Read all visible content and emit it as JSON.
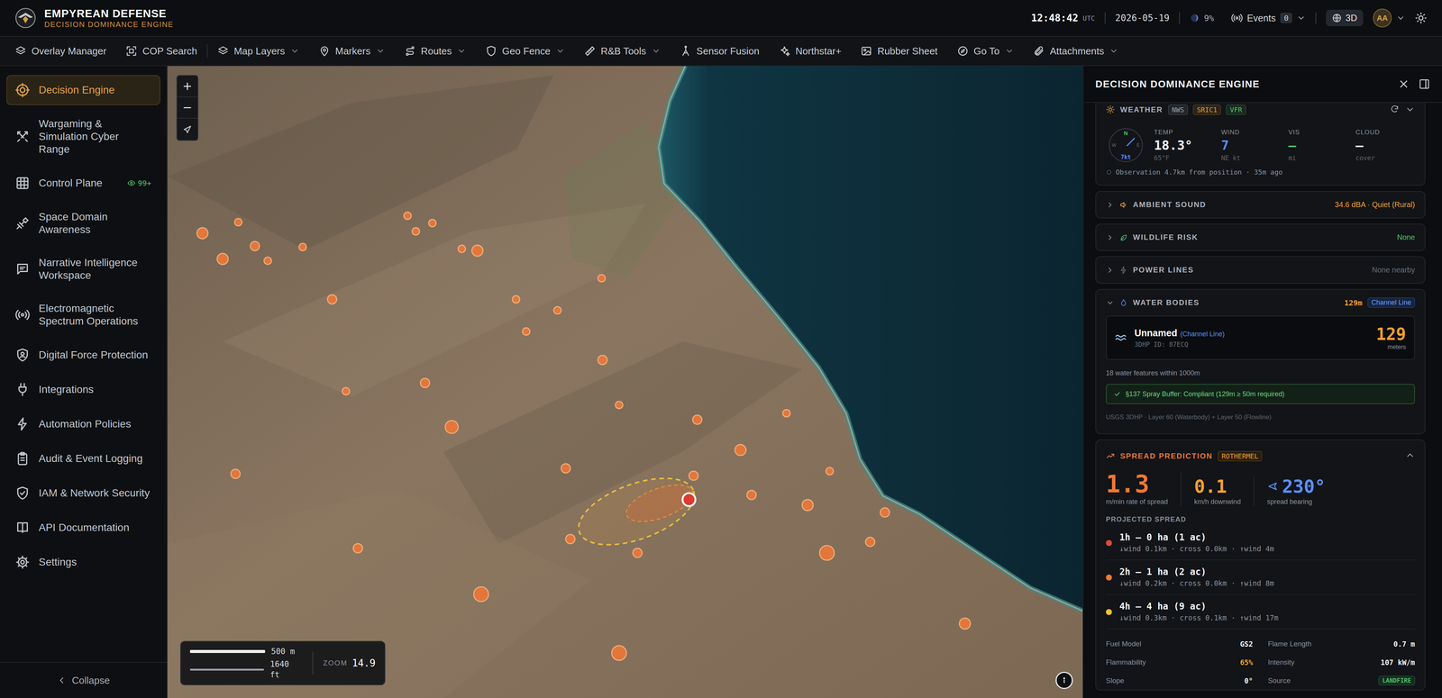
{
  "topbar": {
    "brand": "EMPYREAN DEFENSE",
    "subtitle": "DECISION DOMINANCE ENGINE",
    "time": "12:48:42",
    "timezone": "UTC",
    "date": "2026-05-19",
    "moon_illumination": "9%",
    "events_label": "Events",
    "events_count": "0",
    "view_mode": "3D",
    "avatar": "AA"
  },
  "toolbar": [
    {
      "label": "Overlay Manager",
      "dropdown": false
    },
    {
      "label": "COP Search",
      "dropdown": false
    },
    {
      "label": "Map Layers",
      "dropdown": true
    },
    {
      "label": "Markers",
      "dropdown": true
    },
    {
      "label": "Routes",
      "dropdown": true
    },
    {
      "label": "Geo Fence",
      "dropdown": true
    },
    {
      "label": "R&B Tools",
      "dropdown": true
    },
    {
      "label": "Sensor Fusion",
      "dropdown": false
    },
    {
      "label": "Northstar+",
      "dropdown": false
    },
    {
      "label": "Rubber Sheet",
      "dropdown": false
    },
    {
      "label": "Go To",
      "dropdown": true
    },
    {
      "label": "Attachments",
      "dropdown": true
    }
  ],
  "sidebar": {
    "items": [
      {
        "label": "Decision Engine",
        "selected": true
      },
      {
        "label": "Wargaming & Simulation Cyber Range",
        "selected": false
      },
      {
        "label": "Control Plane",
        "selected": false,
        "badge": "99+"
      },
      {
        "label": "Space Domain Awareness",
        "selected": false
      },
      {
        "label": "Narrative Intelligence Workspace",
        "selected": false
      },
      {
        "label": "Electromagnetic Spectrum Operations",
        "selected": false
      },
      {
        "label": "Digital Force Protection",
        "selected": false
      },
      {
        "label": "Integrations",
        "selected": false
      },
      {
        "label": "Automation Policies",
        "selected": false
      },
      {
        "label": "Audit & Event Logging",
        "selected": false
      },
      {
        "label": "IAM & Network Security",
        "selected": false
      },
      {
        "label": "API Documentation",
        "selected": false
      },
      {
        "label": "Settings",
        "selected": false
      }
    ],
    "collapse": "Collapse"
  },
  "map": {
    "scale_metric": "500 m",
    "scale_imperial": "1640 ft",
    "zoom_label": "ZOOM",
    "zoom": "14.9"
  },
  "panel": {
    "title": "DECISION DOMINANCE ENGINE",
    "weather": {
      "title": "WEATHER",
      "expanded": true,
      "tags": [
        {
          "label": "NWS",
          "color": "#9aa0a6"
        },
        {
          "label": "SRIC1",
          "color": "#e0a030"
        },
        {
          "label": "VFR",
          "color": "#5cc05c"
        }
      ],
      "compass_n": "N",
      "compass_w": "W",
      "compass_e": "E",
      "compass_speed": "7kt",
      "stats": [
        {
          "label": "TEMP",
          "value": "18.3°",
          "unit": "65°F",
          "color": "#f2f3f5"
        },
        {
          "label": "WIND",
          "value": "7",
          "unit": "NE kt",
          "color": "#5b8ff9"
        },
        {
          "label": "VIS",
          "value": "—",
          "unit": "mi",
          "color": "#4cc46a"
        },
        {
          "label": "CLOUD",
          "value": "—",
          "unit": "cover",
          "color": "#f2f3f5"
        }
      ],
      "observation": "Observation 4.7km from position · 35m ago"
    },
    "sections": [
      {
        "title": "AMBIENT SOUND",
        "value": "34.6 dBA · Quiet (Rural)",
        "color": "#f0a030",
        "expanded": false
      },
      {
        "title": "WILDLIFE RISK",
        "value": "None",
        "color": "#4cc46a",
        "expanded": false
      },
      {
        "title": "POWER LINES",
        "value": "None nearby",
        "color": "#6b7078",
        "expanded": false
      }
    ],
    "water": {
      "title": "WATER BODIES",
      "expanded": true,
      "distance": "129m",
      "tag": "Channel Line",
      "name": "Unnamed",
      "type": "(Channel Line)",
      "id": "3DHP ID: 87ECQ",
      "meters": "129",
      "meters_unit": "meters",
      "count": "18 water features within 1000m",
      "compliance": "§137 Spray Buffer: Compliant (129m ≥ 50m required)",
      "source": "USGS 3DHP · Layer 60 (Waterbody) + Layer 50 (Flowline)"
    },
    "spread": {
      "title": "SPREAD PREDICTION",
      "tag": "ROTHERMEL",
      "expanded": true,
      "stats": [
        {
          "value": "1.3",
          "label": "m/min rate of spread",
          "color": "#f07830"
        },
        {
          "value": "0.1",
          "label": "km/h downwind",
          "color": "#f0a030"
        },
        {
          "value": "230°",
          "label": "spread bearing",
          "color": "#5b8ff9"
        }
      ],
      "projected_title": "PROJECTED SPREAD",
      "rows": [
        {
          "title": "1h — 0 ha (1 ac)",
          "detail": "↓wind 0.1km · cross 0.0km · ↑wind 4m",
          "color": "#e04a3a"
        },
        {
          "title": "2h — 1 ha (2 ac)",
          "detail": "↓wind 0.2km · cross 0.0km · ↑wind 8m",
          "color": "#f07830"
        },
        {
          "title": "4h — 4 ha (9 ac)",
          "detail": "↓wind 0.3km · cross 0.1km · ↑wind 17m",
          "color": "#f0c030"
        }
      ],
      "props": [
        {
          "label": "Fuel Model",
          "value": "GS2",
          "kind": "text",
          "color": "#f2f3f5"
        },
        {
          "label": "Flame Length",
          "value": "0.7 m",
          "kind": "text",
          "color": "#f2f3f5"
        },
        {
          "label": "Flammability",
          "value": "65%",
          "kind": "text",
          "color": "#f0a030"
        },
        {
          "label": "Intensity",
          "value": "107 kW/m",
          "kind": "text",
          "color": "#f2f3f5"
        },
        {
          "label": "Slope",
          "value": "0°",
          "kind": "text",
          "color": "#f2f3f5"
        },
        {
          "label": "Source",
          "value": "LANDFIRE",
          "kind": "tag",
          "color": "#4cc46a"
        }
      ]
    }
  }
}
